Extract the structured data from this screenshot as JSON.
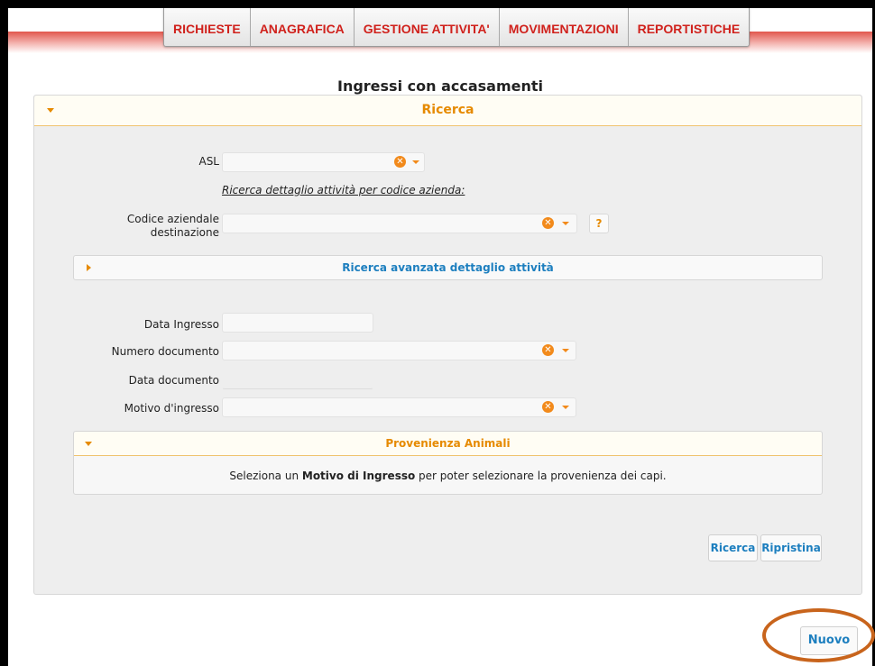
{
  "nav": {
    "items": [
      "RICHIESTE",
      "ANAGRAFICA",
      "GESTIONE ATTIVITA'",
      "MOVIMENTAZIONI",
      "REPORTISTICHE"
    ]
  },
  "page_title": "Ingressi con accasamenti",
  "ricerca": {
    "title": "Ricerca",
    "asl_label": "ASL",
    "link_text": "Ricerca dettaglio attività per codice azienda:",
    "codice_label_1": "Codice aziendale",
    "codice_label_2": "destinazione",
    "help_label": "?",
    "avanzata_title": "Ricerca avanzata dettaglio attività",
    "data_ingresso_label": "Data Ingresso",
    "numero_documento_label": "Numero documento",
    "data_documento_label": "Data documento",
    "motivo_label": "Motivo d'ingresso",
    "provenienza_title": "Provenienza Animali",
    "provenienza_msg_pre": "Seleziona un ",
    "provenienza_msg_bold": "Motivo di Ingresso",
    "provenienza_msg_post": " per poter selezionare la provenienza dei capi.",
    "clear_glyph": "✕"
  },
  "buttons": {
    "ricerca": "Ricerca",
    "ripristina": "Ripristina",
    "nuovo": "Nuovo"
  },
  "colors": {
    "nav_text": "#d0211c",
    "panel_accent": "#e68a00",
    "button_text": "#1d7fbf",
    "annotation_oval": "#c8641c"
  }
}
